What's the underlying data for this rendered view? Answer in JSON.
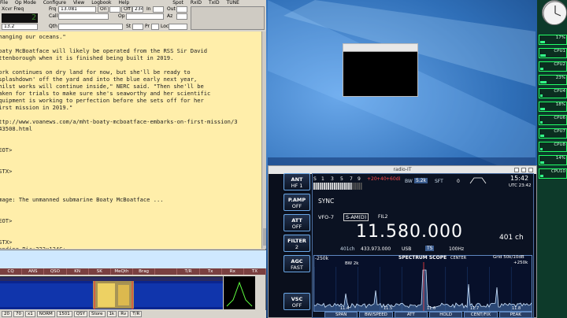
{
  "menubar": [
    "File",
    "Op Mode",
    "Configure",
    "View",
    "Logbook",
    "Help"
  ],
  "toolbar_right": [
    "Spot",
    "RxID",
    "TxID",
    "TUNE"
  ],
  "fields": {
    "frq_label": "Frq",
    "frq_value": "13.081",
    "on_label": "On",
    "off_label": "Off",
    "off_value": "2342",
    "in_label": "In",
    "out_label": "Out",
    "call_label": "Call",
    "op_label": "Op",
    "az_label": "Az",
    "qth_label": "Qth",
    "st_label": "St",
    "pr_label": "Pr",
    "loc_label": "Loc",
    "xcvr_label": "Xcvr Freq",
    "freq_display": "11.580",
    "freq_lead": "2",
    "mode_value": "13.2"
  },
  "rx_text": [
    "changing our oceans.\"",
    "",
    "Boaty McBoatface will likely be operated from the RSS Sir David",
    "Attenborough when it is finished being built in 2019.",
    "",
    "Work continues on dry land for now, but she'll be ready to",
    "'splashdown' off the yard and into the blue early next year,",
    "whilst works will continue inside,\" NERC said. \"Then she'll be",
    "taken for trials to make sure she's seaworthy and her scientific",
    "equipment is working to perfection before she sets off for her",
    "first mission in 2019.\"",
    "",
    "http://www.voanews.com/a/mht-boaty-mcboatface-embarks-on-first-mission/3",
    "843508.html",
    "",
    "",
    "<EOT>",
    "",
    "",
    "<STX>",
    "",
    "",
    "",
    "Image: The unmanned submarine Boaty McBoatface ...",
    "",
    "",
    "<EOT>",
    "",
    "",
    "<STX>",
    "Sending Pic:223x134C;"
  ],
  "macros": [
    "CQ",
    "ANS",
    "QSO",
    "KN",
    "SK",
    "MeQth",
    "Brag",
    "",
    "T/R",
    "Tx",
    "Rx",
    "TX"
  ],
  "ctrlbar": [
    "20",
    "70",
    "x1",
    "NORM",
    "1501",
    "QSY",
    "Store",
    "1k",
    "Rv",
    "T/R"
  ],
  "radio": {
    "title": "radio-IT",
    "buttons_left": [
      {
        "top": "ANT",
        "bottom": "HF 1"
      },
      {
        "top": "P.AMP",
        "bottom": "OFF"
      },
      {
        "top": "ATT",
        "bottom": "OFF"
      },
      {
        "top": "FILTER",
        "bottom": "2"
      },
      {
        "top": "AGC",
        "bottom": "FAST"
      },
      {
        "top": "VSC",
        "bottom": "OFF"
      }
    ],
    "smeter_labels": [
      "S",
      "1",
      "3",
      "5",
      "7",
      "9",
      "+20",
      "+40",
      "+60dB"
    ],
    "bw_label": "BW",
    "bw_value": "5.2k",
    "sft_label": "SFT",
    "sft_value": "0",
    "clock": "15:42",
    "clock_sub": "UTC 23:42",
    "sync": "SYNC",
    "vfo": "VFO-7",
    "mode": "S-AM(D)",
    "fil": "FIL2",
    "frequency": "11.580.000",
    "channel": "401 ch",
    "memch": "401ch",
    "memfreq": "433.973.000",
    "memmode": "USB",
    "ts": "TS",
    "step": "100Hz",
    "scope_title": "SPECTRUM SCOPE",
    "scope_center": "CENTER",
    "scope_span": "-250k",
    "scope_span2": "+250k",
    "scope_grid": "Grid  50k/10dB",
    "scope_bw": "BW 2k",
    "scope_ticks": [
      "11.4",
      "11.5",
      "11.6",
      "11.7",
      "11.8"
    ],
    "bottom_buttons": [
      "SPAN",
      "BW/SPEED",
      "ATT",
      "HOLD",
      "CENT/FIX",
      "PEAK"
    ]
  },
  "sysmon": {
    "cpus": [
      {
        "label": "17%",
        "name": "CPU",
        "level": 0.17
      },
      {
        "label": "CPU1",
        "name": "CPU1",
        "level": 0.2
      },
      {
        "label": "CPU2",
        "name": "CPU2",
        "level": 0.12
      },
      {
        "label": "23%",
        "name": "CPU3",
        "level": 0.23
      },
      {
        "label": "CPU4",
        "name": "CPU4",
        "level": 0.1
      },
      {
        "label": "18%",
        "name": "CPU5",
        "level": 0.18
      },
      {
        "label": "CPU6",
        "name": "CPU6",
        "level": 0.08
      },
      {
        "label": "CPU7",
        "name": "CPU7",
        "level": 0.15
      },
      {
        "label": "CPU8",
        "name": "CPU8",
        "level": 0.09
      },
      {
        "label": "14%",
        "name": "CPU9",
        "level": 0.14
      },
      {
        "label": "CPU10",
        "name": "CPU10",
        "level": 0.11
      }
    ]
  },
  "colors": {
    "rx_bg": "#ffeeaa",
    "freq_fg": "#7fff3f",
    "radio_accent": "#6aa7e6"
  }
}
